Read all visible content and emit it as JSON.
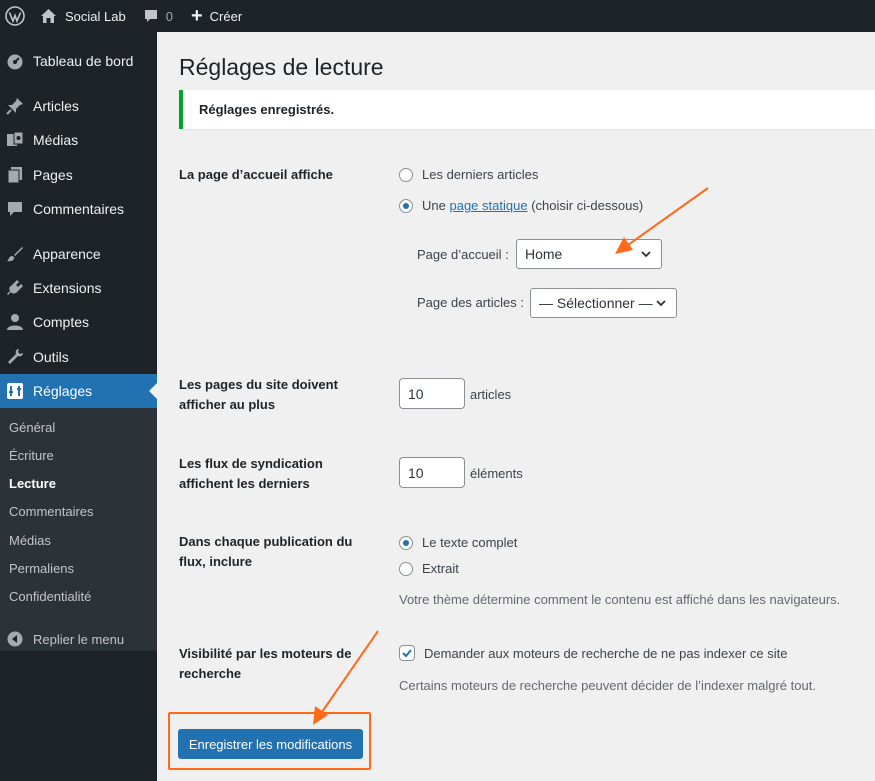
{
  "adminbar": {
    "site_name": "Social Lab",
    "comments_count": "0",
    "new_label": "Créer"
  },
  "sidebar": {
    "items": [
      {
        "label": "Tableau de bord",
        "icon": "dashboard-icon"
      },
      {
        "label": "Articles",
        "icon": "pin-icon"
      },
      {
        "label": "Médias",
        "icon": "media-icon"
      },
      {
        "label": "Pages",
        "icon": "pages-icon"
      },
      {
        "label": "Commentaires",
        "icon": "comment-icon"
      },
      {
        "label": "Apparence",
        "icon": "brush-icon"
      },
      {
        "label": "Extensions",
        "icon": "plugin-icon"
      },
      {
        "label": "Comptes",
        "icon": "user-icon"
      },
      {
        "label": "Outils",
        "icon": "wrench-icon"
      },
      {
        "label": "Réglages",
        "icon": "settings-icon"
      }
    ],
    "submenu": [
      "Général",
      "Écriture",
      "Lecture",
      "Commentaires",
      "Médias",
      "Permaliens",
      "Confidentialité"
    ],
    "collapse_label": "Replier le menu"
  },
  "page": {
    "title": "Réglages de lecture",
    "notice": "Réglages enregistrés.",
    "homepage": {
      "label": "La page d’accueil affiche",
      "option_latest": "Les derniers articles",
      "option_static_prefix": "Une",
      "option_static_link": "page statique",
      "option_static_suffix": "(choisir ci-dessous)",
      "front_label": "Page d’accueil :",
      "front_value": "Home",
      "posts_label": "Page des articles :",
      "posts_value": "— Sélectionner —"
    },
    "per_page": {
      "label": "Les pages du site doivent afficher au plus",
      "value": "10",
      "unit": "articles"
    },
    "feed": {
      "label": "Les flux de syndication affichent les derniers",
      "value": "10",
      "unit": "éléments"
    },
    "feed_content": {
      "label": "Dans chaque publication du flux, inclure",
      "option_full": "Le texte complet",
      "option_excerpt": "Extrait",
      "description": "Votre thème détermine comment le contenu est affiché dans les navigateurs."
    },
    "visibility": {
      "label": "Visibilité par les moteurs de recherche",
      "checkbox_label": "Demander aux moteurs de recherche de ne pas indexer ce site",
      "description": "Certains moteurs de recherche peuvent décider de l’indexer malgré tout."
    },
    "save_button": "Enregistrer les modifications"
  },
  "colors": {
    "adminbar_bg": "#1d2327",
    "accent": "#2271b1",
    "success": "#00a32a",
    "annotation": "#ff6a1a"
  }
}
